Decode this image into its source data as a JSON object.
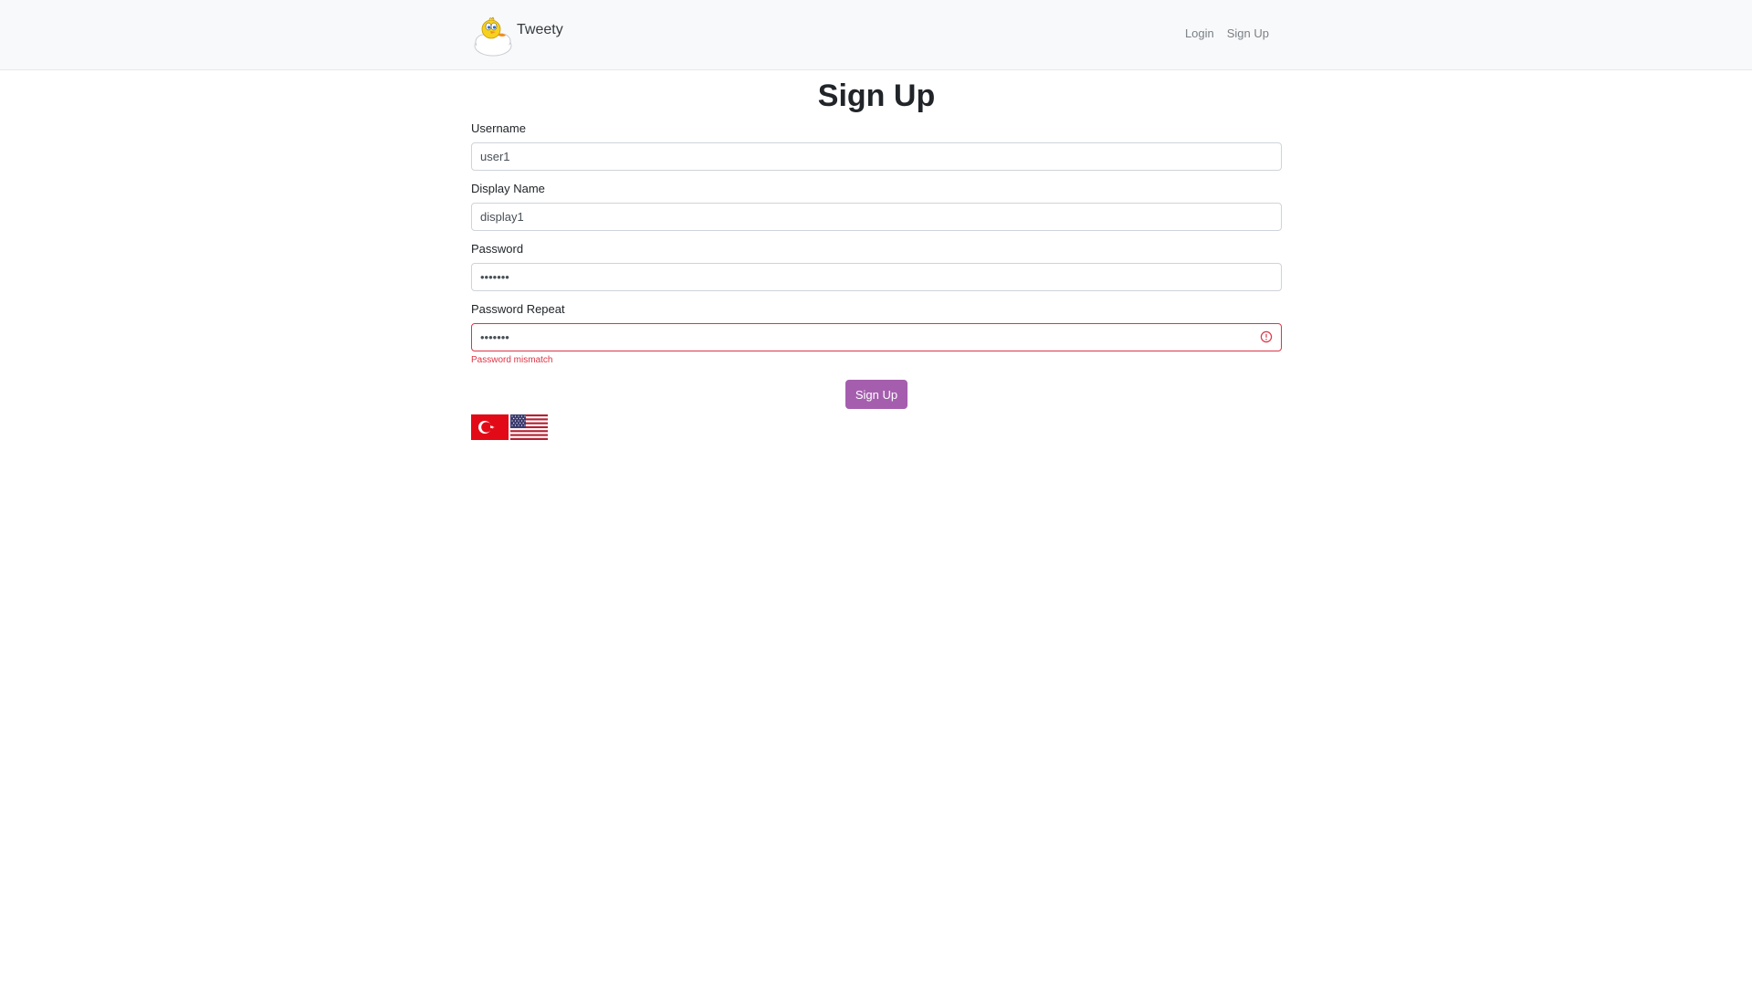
{
  "navbar": {
    "brand_name": "Tweety",
    "brand_logo_icon": "tweety-bird-on-cloud-icon",
    "links": [
      {
        "label": "Login"
      },
      {
        "label": "Sign Up"
      }
    ]
  },
  "page": {
    "title": "Sign Up"
  },
  "form": {
    "username": {
      "label": "Username",
      "value": "user1"
    },
    "display_name": {
      "label": "Display Name",
      "value": "display1"
    },
    "password": {
      "label": "Password",
      "value": "1234567"
    },
    "password_repeat": {
      "label": "Password Repeat",
      "value": "1234567",
      "error": "Password mismatch"
    },
    "submit_label": "Sign Up"
  },
  "languages": [
    {
      "name": "turkish-flag-icon",
      "code": "tr"
    },
    {
      "name": "us-flag-icon",
      "code": "en"
    }
  ],
  "colors": {
    "accent": "#a55eae",
    "error": "#dc3545",
    "navbar_bg": "#f8f9fa"
  }
}
